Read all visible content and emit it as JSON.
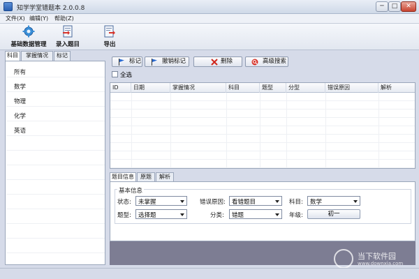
{
  "window": {
    "title": "知学学堂错题本 2.0.0.8",
    "min_glyph": "─",
    "max_glyph": "□",
    "close_glyph": "✕"
  },
  "menu": {
    "file": "文件(X)",
    "edit": "编辑(Y)",
    "help": "帮助(Z)"
  },
  "toolbar": {
    "base_data": "基础数据管理",
    "entry": "录入题目",
    "export": "导出"
  },
  "left_tabs": {
    "subject": "科目",
    "mastery": "掌握情况",
    "mark": "标记"
  },
  "subjects": [
    "所有",
    "数学",
    "物理",
    "化学",
    "英语"
  ],
  "actions": {
    "mark": "标记",
    "unmark": "撤销标记",
    "delete": "删除",
    "advanced_search": "高级搜索",
    "select_all": "全选"
  },
  "grid": {
    "columns": [
      "ID",
      "日期",
      "掌握情况",
      "科目",
      "题型",
      "分型",
      "错误原因",
      "解析"
    ]
  },
  "detail_tabs": {
    "info": "题目信息",
    "original": "原题",
    "analysis": "解析"
  },
  "detail": {
    "group_title": "基本信息",
    "status_label": "状态:",
    "status_value": "未掌握",
    "reason_label": "错误原因:",
    "reason_value": "看错题目",
    "subject_label": "科目:",
    "subject_value": "数学",
    "type_label": "题型:",
    "type_value": "选择题",
    "category_label": "分类:",
    "category_value": "错题",
    "grade_label": "年级:",
    "grade_value": "初一"
  },
  "watermark": {
    "text": "当下软件园",
    "url": "www.downxia.com"
  },
  "colors": {
    "accent": "#2a5fb0",
    "gray_area": "#7d7d93",
    "close": "#c8432f"
  }
}
